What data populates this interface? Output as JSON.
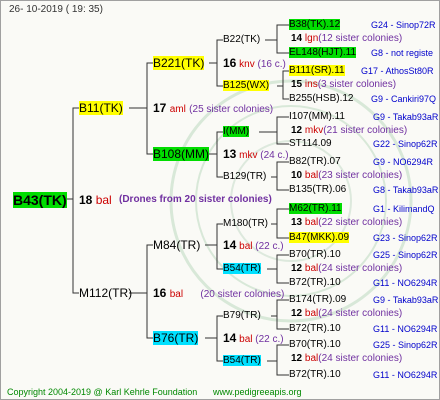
{
  "header": {
    "date": "26- 10-2019 ( 19: 35)"
  },
  "root": {
    "name": "B43(TK)",
    "gen": "18",
    "abbr": "bal",
    "drones": "(Drones from 20 sister colonies)"
  },
  "b11": {
    "name": "B11(TK)",
    "gen": "17",
    "abbr": "aml",
    "note": "(25 sister colonies)"
  },
  "m112": {
    "name": "M112(TR)",
    "gen": "16",
    "abbr": "bal",
    "note": "(20 sister colonies)"
  },
  "b221": {
    "name": "B221(TK)",
    "gen": "16",
    "abbr": "knv",
    "note": "(16 c.)"
  },
  "b108": {
    "name": "B108(MM)",
    "gen": "13",
    "abbr": "mkv",
    "note": "(24 c.)"
  },
  "m84": {
    "name": "M84(TR)",
    "gen": "14",
    "abbr": "bal",
    "note": "(22 c.)"
  },
  "b76": {
    "name": "B76(TR)",
    "gen": "14",
    "abbr": "bal",
    "note": "(22 c.)"
  },
  "g3": {
    "b22": "B22(TK)",
    "b125": "B125(WX)",
    "i": "I(MM)",
    "b129": "B129(TR)",
    "m180": "M180(TR)",
    "b54a": "B54(TR)",
    "b79": "B79(TR)",
    "b54b": "B54(TR)"
  },
  "g4": [
    {
      "name": "B38(TK).12",
      "code": "G24 - Sinop72R",
      "hl": "g"
    },
    {
      "gen": "14",
      "abbr": "lgn",
      "note": "(12 sister colonies)"
    },
    {
      "name": "EL148(HJT).11",
      "code": "G8 - not registe",
      "hl": "g"
    },
    {
      "name": "B111(SR).11",
      "code": "G17 - AthosSt80R",
      "hl": "y"
    },
    {
      "gen": "15",
      "abbr": "ins",
      "note": "(3 sister colonies)"
    },
    {
      "name": "B255(HSB).12",
      "code": "G9 - Cankiri97Q"
    },
    {
      "name": "I107(MM).11",
      "code": "G9 - Takab93aR"
    },
    {
      "gen": "12",
      "abbr": "mkv",
      "note": "(21 sister colonies)"
    },
    {
      "name": "ST114.09",
      "code": "G22 - Sinop62R"
    },
    {
      "name": "B82(TR).07",
      "code": "G9 - NO6294R"
    },
    {
      "gen": "10",
      "abbr": "bal",
      "note": "(23 sister colonies)"
    },
    {
      "name": "B135(TR).06",
      "code": "G8 - Takab93aR"
    },
    {
      "name": "M62(TR).11",
      "code": "G1 - KilimandQ",
      "hl": "g"
    },
    {
      "gen": "13",
      "abbr": "bal",
      "note": "(22 sister colonies)"
    },
    {
      "name": "B47(MKK).09",
      "code": "G23 - Sinop62R",
      "hl": "y"
    },
    {
      "name": "B70(TR).10",
      "code": "G25 - Sinop62R"
    },
    {
      "gen": "12",
      "abbr": "bal",
      "note": "(24 sister colonies)"
    },
    {
      "name": "B72(TR).10",
      "code": "G11 - NO6294R"
    },
    {
      "name": "B174(TR).09",
      "code": "G9 - Takab93aR"
    },
    {
      "gen": "12",
      "abbr": "bal",
      "note": "(24 sister colonies)"
    },
    {
      "name": "B72(TR).10",
      "code": "G11 - NO6294R"
    },
    {
      "name": "B70(TR).10",
      "code": "G25 - Sinop62R"
    },
    {
      "gen": "12",
      "abbr": "bal",
      "note": "(24 sister colonies)"
    },
    {
      "name": "B72(TR).10",
      "code": "G11 - NO6294R"
    }
  ],
  "footer": {
    "copyright": "Copyright 2004-2019 @ Karl Kehrle Foundation",
    "site": "www.pedigreeapis.org"
  }
}
